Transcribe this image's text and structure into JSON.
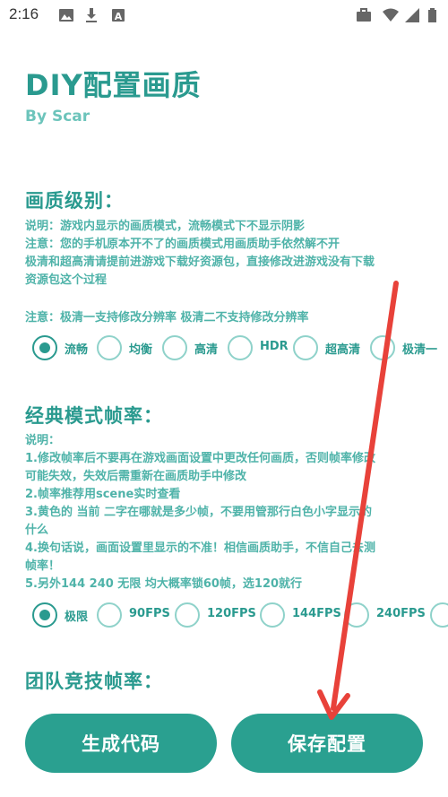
{
  "status_bar": {
    "time": "2:16",
    "icons_left": [
      "image-icon",
      "download-icon",
      "text-a-icon"
    ],
    "icons_right": [
      "briefcase-icon",
      "wifi-icon",
      "signal-icon",
      "battery-icon"
    ]
  },
  "header": {
    "title": "DIY配置画质",
    "subtitle": "By Scar"
  },
  "quality": {
    "title": "画质级别：",
    "notes": [
      "说明：游戏内显示的画质模式，流畅模式下不显示阴影",
      "注意：您的手机原本开不了的画质模式用画质助手依然解不开",
      "极清和超高清请提前进游戏下载好资源包，直接修改进游戏没有下载",
      "资源包这个过程"
    ],
    "note2": "注意：极清一支持修改分辨率 极清二不支持修改分辨率",
    "options": [
      "流畅",
      "均衡",
      "高清",
      "HDR",
      "超高清",
      "极清一"
    ],
    "selected": "流畅"
  },
  "classic_fps": {
    "title": "经典模式帧率：",
    "notes": [
      "说明：",
      "1.修改帧率后不要再在游戏画面设置中更改任何画质，否则帧率修改",
      "可能失效，失效后需重新在画质助手中修改",
      "2.帧率推荐用scene实时查看",
      "3.黄色的 当前 二字在哪就是多少帧，不要用管那行白色小字显示的",
      "什么",
      "4.换句话说，画面设置里显示的不准！相信画质助手，不信自己去测",
      "帧率！",
      "5.另外144 240 无限 均大概率锁60帧，选120就行"
    ],
    "options": [
      "极限",
      "90FPS",
      "120FPS",
      "144FPS",
      "240FPS"
    ],
    "selected": "极限"
  },
  "team_fps": {
    "title": "团队竞技帧率："
  },
  "buttons": {
    "generate": "生成代码",
    "save": "保存配置"
  },
  "annotation": {
    "color": "#e8423a"
  }
}
